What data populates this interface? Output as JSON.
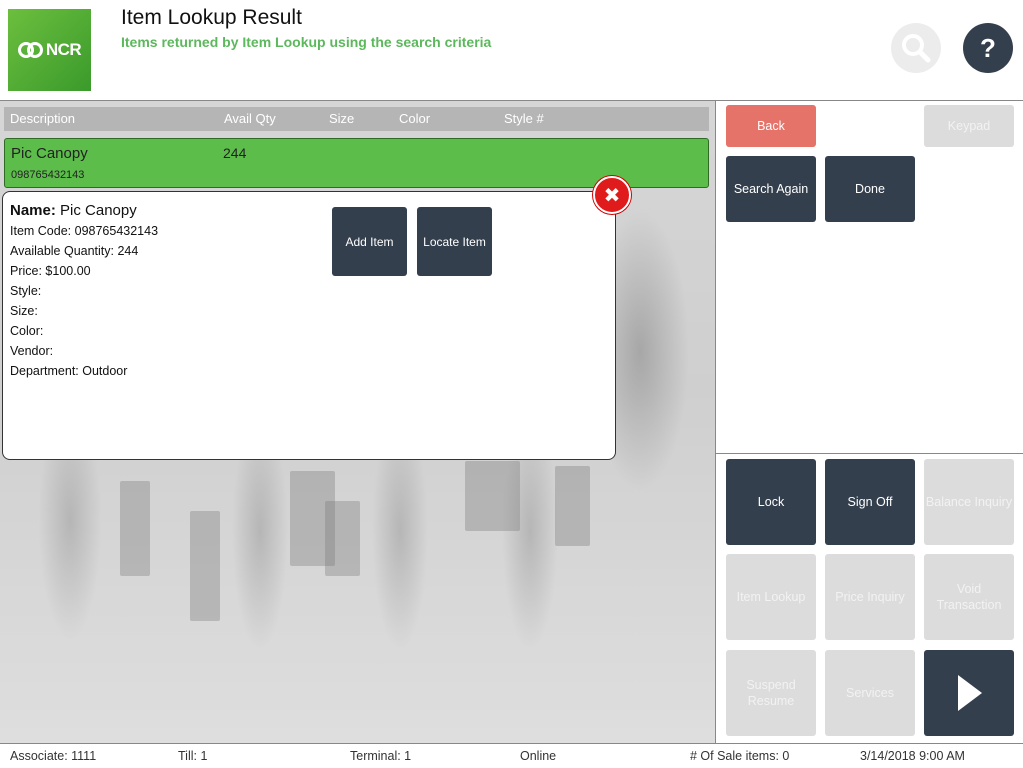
{
  "header": {
    "logo_text": "NCR",
    "title": "Item Lookup Result",
    "subtitle": "Items returned by Item Lookup using the search criteria",
    "help_label": "?"
  },
  "table": {
    "columns": [
      "Description",
      "Avail Qty",
      "Size",
      "Color",
      "Style #"
    ],
    "selected_row": {
      "description": "Pic Canopy",
      "avail_qty": "244",
      "item_code": "098765432143"
    }
  },
  "detail": {
    "name_label": "Name:",
    "name_value": "Pic Canopy",
    "lines": [
      "Item Code: 098765432143",
      "Available Quantity: 244",
      "Price: $100.00",
      "Style:",
      "Size:",
      "Color:",
      "Vendor:",
      "Department: Outdoor"
    ],
    "add_item_label": "Add Item",
    "locate_item_label": "Locate Item",
    "close_label": "✖"
  },
  "actions_top": {
    "back": "Back",
    "keypad": "Keypad",
    "search_again": "Search Again",
    "done": "Done"
  },
  "actions_bottom": {
    "lock": "Lock",
    "sign_off": "Sign Off",
    "balance_inquiry": "Balance Inquiry",
    "item_lookup": "Item Lookup",
    "price_inquiry": "Price Inquiry",
    "void_transaction": "Void Transaction",
    "suspend_resume": "Suspend Resume",
    "services": "Services"
  },
  "footer": {
    "associate": "Associate: 1111",
    "till": "Till: 1",
    "terminal": "Terminal: 1",
    "status": "Online",
    "sale_items": "# Of Sale items: 0",
    "datetime": "3/14/2018 9:00 AM"
  },
  "colors": {
    "accent_green": "#5cbd4a",
    "dark_button": "#343f4e",
    "back_button": "#e57369",
    "close_red": "#e01b1b"
  }
}
